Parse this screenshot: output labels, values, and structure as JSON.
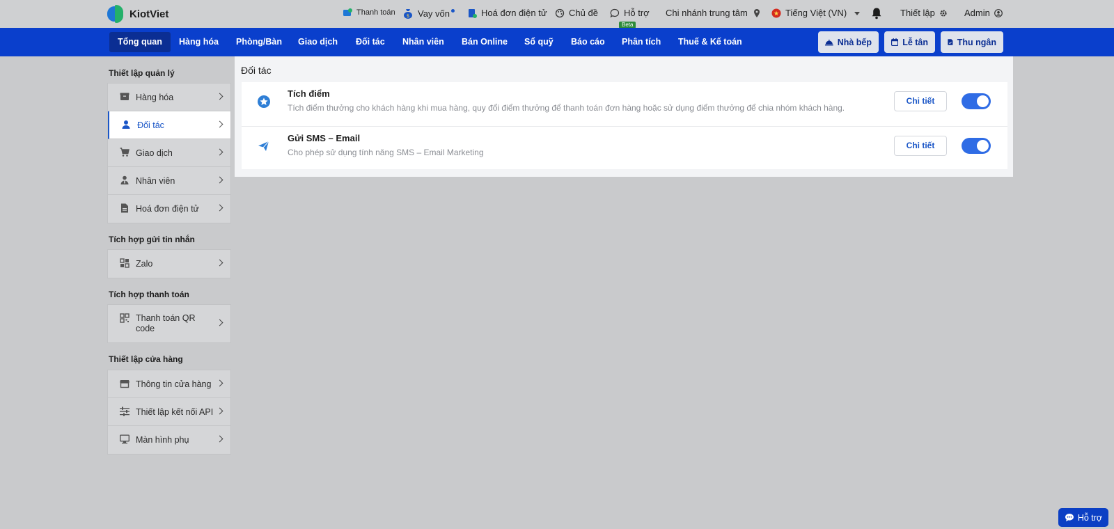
{
  "brand": {
    "name": "KiotViet"
  },
  "topbar": {
    "payment": "Thanh toán",
    "loan": "Vay vốn",
    "einvoice": "Hoá đơn điện tử",
    "theme": "Chủ đề",
    "support": "Hỗ trợ",
    "support_badge": "Beta",
    "branch": "Chi nhánh trung tâm",
    "language": "Tiếng Việt (VN)",
    "settings": "Thiết lập",
    "user": "Admin"
  },
  "nav": {
    "tabs": [
      {
        "label": "Tổng quan",
        "active": true
      },
      {
        "label": "Hàng hóa"
      },
      {
        "label": "Phòng/Bàn"
      },
      {
        "label": "Giao dịch"
      },
      {
        "label": "Đối tác"
      },
      {
        "label": "Nhân viên"
      },
      {
        "label": "Bán Online"
      },
      {
        "label": "Sổ quỹ"
      },
      {
        "label": "Báo cáo"
      },
      {
        "label": "Phân tích"
      },
      {
        "label": "Thuế & Kế toán"
      }
    ],
    "buttons": {
      "kitchen": "Nhà bếp",
      "reception": "Lễ tân",
      "cashier": "Thu ngân"
    }
  },
  "sidebar": {
    "sections": [
      {
        "title": "Thiết lập quản lý",
        "items": [
          {
            "label": "Hàng hóa",
            "icon": "box-icon"
          },
          {
            "label": "Đối tác",
            "icon": "user-icon",
            "active": true
          },
          {
            "label": "Giao dịch",
            "icon": "cart-icon"
          },
          {
            "label": "Nhân viên",
            "icon": "employee-icon"
          },
          {
            "label": "Hoá đơn điện tử",
            "icon": "document-icon"
          }
        ]
      },
      {
        "title": "Tích hợp gửi tin nhắn",
        "items": [
          {
            "label": "Zalo",
            "icon": "grid-icon"
          }
        ]
      },
      {
        "title": "Tích hợp thanh toán",
        "items": [
          {
            "label": "Thanh toán QR code",
            "icon": "qr-icon"
          }
        ]
      },
      {
        "title": "Thiết lập cửa hàng",
        "items": [
          {
            "label": "Thông tin cửa hàng",
            "icon": "store-icon"
          },
          {
            "label": "Thiết lập kết nối API",
            "icon": "sliders-icon"
          },
          {
            "label": "Màn hình phụ",
            "icon": "monitor-icon"
          }
        ]
      }
    ]
  },
  "content": {
    "title": "Đối tác",
    "rows": [
      {
        "title": "Tích điểm",
        "description": "Tích điểm thưởng cho khách hàng khi mua hàng, quy đổi điểm thưởng để thanh toán đơn hàng hoặc sử dụng điểm thưởng để chia nhóm khách hàng.",
        "button": "Chi tiết",
        "enabled": true
      },
      {
        "title": "Gửi SMS – Email",
        "description": "Cho phép sử dụng tính năng SMS – Email Marketing",
        "button": "Chi tiết",
        "enabled": true
      }
    ]
  },
  "help_button": "Hỗ trợ",
  "colors": {
    "nav": "#0a3fcc",
    "accent": "#1a56c7",
    "toggle_on": "#2f6ce5"
  }
}
